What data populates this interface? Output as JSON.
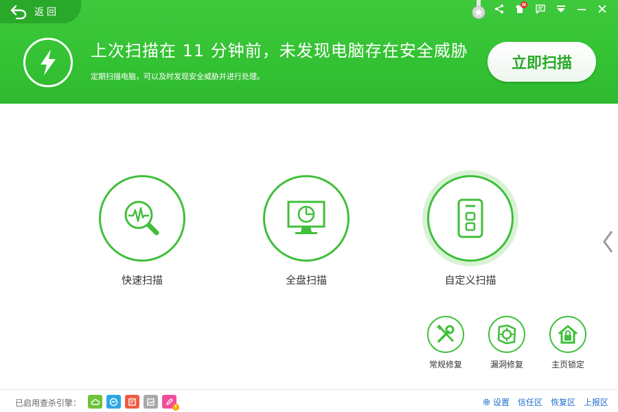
{
  "header": {
    "back_label": "返回",
    "headline": "上次扫描在 11 分钟前，未发现电脑存在安全威胁",
    "subline": "定期扫描电脑，可以及时发现安全威胁并进行处理。",
    "scan_now_label": "立即扫描",
    "notification_badge": "N",
    "icons": [
      "back-arrow-icon",
      "medal-icon",
      "share-icon",
      "shirt-icon",
      "message-icon",
      "menu-icon",
      "minimize-icon",
      "close-icon",
      "lightning-icon"
    ]
  },
  "scan_options": [
    {
      "label": "快速扫描",
      "icon": "quick-scan-icon"
    },
    {
      "label": "全盘扫描",
      "icon": "monitor-icon"
    },
    {
      "label": "自定义扫描",
      "icon": "custom-scan-icon"
    }
  ],
  "tools": [
    {
      "label": "常规修复",
      "icon": "wrench-screwdriver-icon"
    },
    {
      "label": "漏洞修复",
      "icon": "vulnerability-icon"
    },
    {
      "label": "主页锁定",
      "icon": "home-lock-icon"
    }
  ],
  "footer": {
    "engine_label": "已启用查杀引擎：",
    "engine_warning": "!",
    "links": [
      {
        "label": "设置",
        "icon": "gear-icon"
      },
      {
        "label": "信任区"
      },
      {
        "label": "恢复区"
      },
      {
        "label": "上报区"
      }
    ]
  },
  "colors": {
    "brand_green": "#33c233",
    "ring_green": "#3fbf3a",
    "link_blue": "#1e6fcf"
  }
}
